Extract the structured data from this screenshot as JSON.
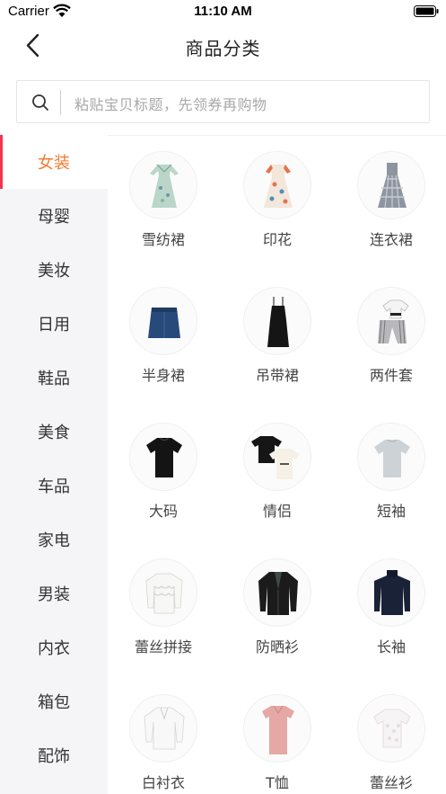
{
  "status_bar": {
    "carrier": "Carrier",
    "time": "11:10 AM"
  },
  "nav": {
    "title": "商品分类"
  },
  "search": {
    "placeholder": "粘贴宝贝标题，先领券再购物"
  },
  "colors": {
    "accent": "#f47b31",
    "indicator": "#f2354f",
    "sidebar_bg": "#f5f5f8"
  },
  "sidebar": {
    "items": [
      {
        "label": "女装",
        "active": true
      },
      {
        "label": "母婴",
        "active": false
      },
      {
        "label": "美妆",
        "active": false
      },
      {
        "label": "日用",
        "active": false
      },
      {
        "label": "鞋品",
        "active": false
      },
      {
        "label": "美食",
        "active": false
      },
      {
        "label": "车品",
        "active": false
      },
      {
        "label": "家电",
        "active": false
      },
      {
        "label": "男装",
        "active": false
      },
      {
        "label": "内衣",
        "active": false
      },
      {
        "label": "箱包",
        "active": false
      },
      {
        "label": "配饰",
        "active": false
      }
    ]
  },
  "categories": [
    {
      "label": "雪纺裙",
      "icon": "floral-dress-icon"
    },
    {
      "label": "印花",
      "icon": "printed-dress-icon"
    },
    {
      "label": "连衣裙",
      "icon": "plaid-dress-icon"
    },
    {
      "label": "半身裙",
      "icon": "denim-skirt-icon"
    },
    {
      "label": "吊带裙",
      "icon": "slip-dress-icon"
    },
    {
      "label": "两件套",
      "icon": "two-piece-set-icon"
    },
    {
      "label": "大码",
      "icon": "black-tshirt-icon"
    },
    {
      "label": "情侣",
      "icon": "couple-tshirts-icon"
    },
    {
      "label": "短袖",
      "icon": "grey-tshirt-icon"
    },
    {
      "label": "蕾丝拼接",
      "icon": "lace-blouse-icon"
    },
    {
      "label": "防晒衫",
      "icon": "sun-cardigan-icon"
    },
    {
      "label": "长袖",
      "icon": "navy-sweater-icon"
    },
    {
      "label": "白衬衣",
      "icon": "white-shirt-icon"
    },
    {
      "label": "T恤",
      "icon": "pink-tshirt-icon"
    },
    {
      "label": "蕾丝衫",
      "icon": "lace-top-icon"
    }
  ]
}
